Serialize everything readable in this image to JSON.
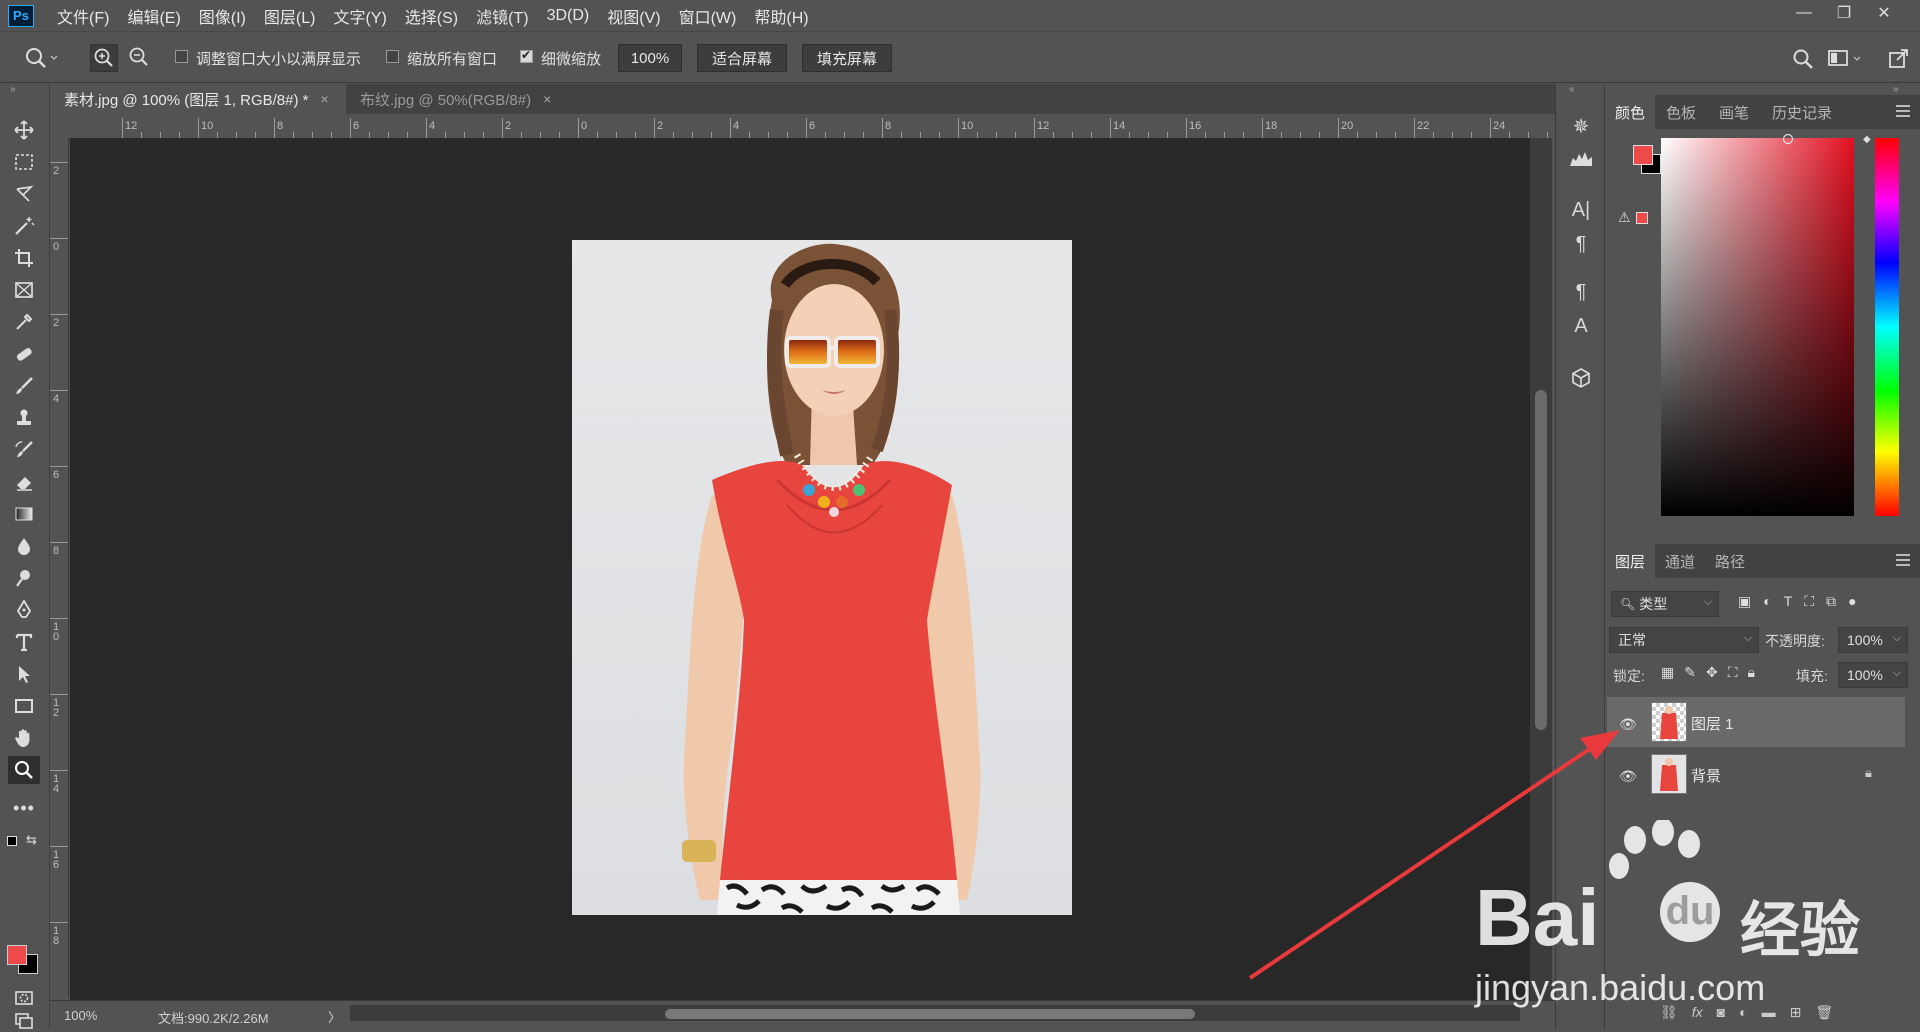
{
  "menubar": {
    "logo": "Ps",
    "items": [
      "文件(F)",
      "编辑(E)",
      "图像(I)",
      "图层(L)",
      "文字(Y)",
      "选择(S)",
      "滤镜(T)",
      "3D(D)",
      "视图(V)",
      "窗口(W)",
      "帮助(H)"
    ]
  },
  "options": {
    "resize_window": "调整窗口大小以满屏显示",
    "zoom_all": "缩放所有窗口",
    "scrubby_zoom": "细微缩放",
    "zoom_value": "100%",
    "fit_screen": "适合屏幕",
    "fill_screen": "填充屏幕"
  },
  "tabs": [
    {
      "label": "素材.jpg @ 100% (图层 1, RGB/8#) *",
      "close": "×"
    },
    {
      "label": "布纹.jpg @ 50%(RGB/8#)",
      "close": "×"
    }
  ],
  "rulers": {
    "h": [
      "12",
      "10",
      "8",
      "6",
      "4",
      "2",
      "0",
      "2",
      "4",
      "6",
      "8",
      "10",
      "12",
      "14",
      "16",
      "18",
      "20",
      "22",
      "24"
    ],
    "v": [
      "2",
      "0",
      "2",
      "4",
      "6",
      "8",
      "1\n0",
      "1\n2",
      "1\n4",
      "1\n6",
      "1\n8"
    ]
  },
  "status": {
    "zoom": "100%",
    "doc": "文档:990.2K/2.26M",
    "arrow": "〉"
  },
  "color_panel": {
    "tabs": [
      "颜色",
      "色板",
      "画笔",
      "历史记录"
    ],
    "foreground": "#ef4a4a",
    "background": "#000000"
  },
  "layers_panel": {
    "tabs": [
      "图层",
      "通道",
      "路径"
    ],
    "filter": "类型",
    "blend_mode": "正常",
    "opacity_label": "不透明度:",
    "opacity": "100%",
    "lock_label": "锁定:",
    "fill_label": "填充:",
    "fill": "100%",
    "layers": [
      {
        "name": "图层 1",
        "selected": true
      },
      {
        "name": "背景",
        "locked": true
      }
    ],
    "footer_fx": "fx"
  },
  "watermark": {
    "brand": "Bai",
    "brand2": "du",
    "cn": "经验",
    "url": "jingyan.baidu.com"
  },
  "accent_colors": {
    "selection": "#696969",
    "arrow": "#e8393c",
    "swatch": "#ef4a4a"
  }
}
